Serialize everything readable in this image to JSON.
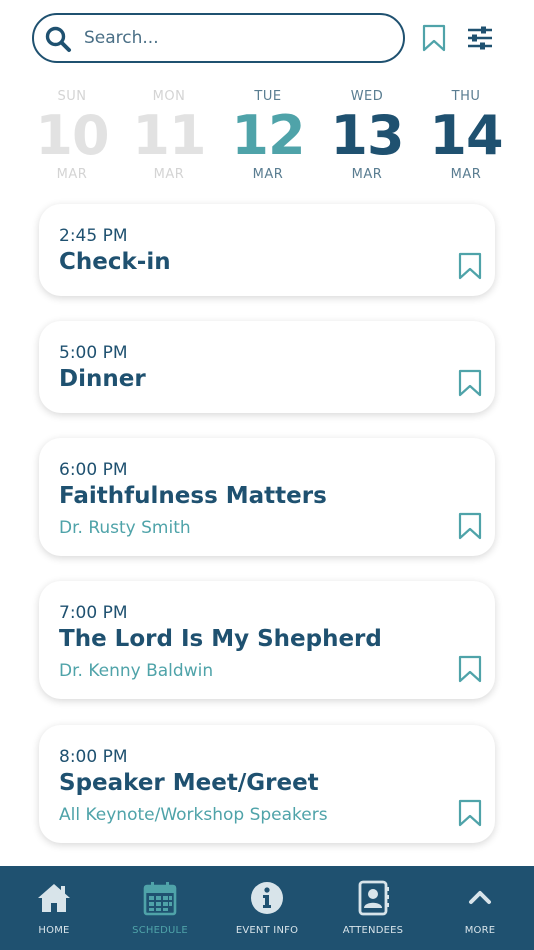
{
  "search": {
    "placeholder": "Search..."
  },
  "header": {
    "icons": [
      "search-icon",
      "bookmark-icon",
      "filter-sliders-icon"
    ]
  },
  "dates": [
    {
      "dow": "SUN",
      "num": "10",
      "mon": "MAR",
      "state": "past"
    },
    {
      "dow": "MON",
      "num": "11",
      "mon": "MAR",
      "state": "past"
    },
    {
      "dow": "TUE",
      "num": "12",
      "mon": "MAR",
      "state": "selected"
    },
    {
      "dow": "WED",
      "num": "13",
      "mon": "MAR",
      "state": "future"
    },
    {
      "dow": "THU",
      "num": "14",
      "mon": "MAR",
      "state": "future"
    }
  ],
  "events": [
    {
      "time": "2:45 PM",
      "title": "Check-in",
      "speaker": ""
    },
    {
      "time": "5:00 PM",
      "title": "Dinner",
      "speaker": ""
    },
    {
      "time": "6:00 PM",
      "title": "Faithfulness Matters",
      "speaker": "Dr. Rusty Smith"
    },
    {
      "time": "7:00 PM",
      "title": "The Lord Is My Shepherd",
      "speaker": "Dr. Kenny Baldwin"
    },
    {
      "time": "8:00 PM",
      "title": "Speaker Meet/Greet",
      "speaker": "All Keynote/Workshop Speakers"
    }
  ],
  "nav": [
    {
      "label": "HOME",
      "icon": "home-icon",
      "active": false
    },
    {
      "label": "SCHEDULE",
      "icon": "calendar-icon",
      "active": true
    },
    {
      "label": "EVENT INFO",
      "icon": "info-icon",
      "active": false
    },
    {
      "label": "ATTENDEES",
      "icon": "contacts-icon",
      "active": false
    },
    {
      "label": "MORE",
      "icon": "chevron-up-icon",
      "active": false
    }
  ],
  "colors": {
    "primary": "#1f5170",
    "accent": "#4fa3a9",
    "muted": "#e2e2e2",
    "nav_bg": "#1f5170"
  }
}
